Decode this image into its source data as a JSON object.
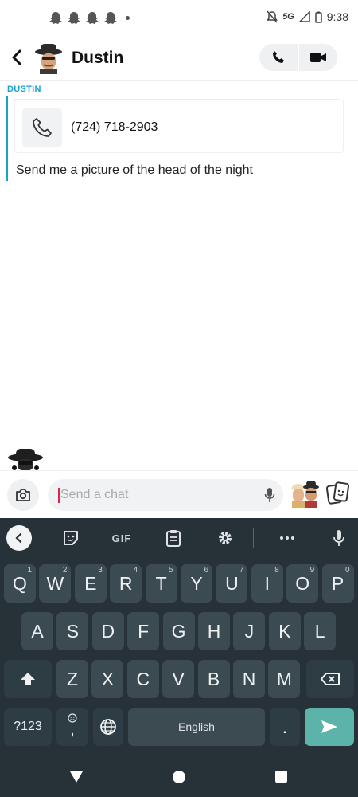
{
  "status_bar": {
    "network": "5G",
    "time": "9:38",
    "icons": [
      "snapchat-ghost-icon",
      "snapchat-ghost-icon",
      "snapchat-ghost-icon",
      "snapchat-ghost-icon",
      "notification-dot",
      "mute-icon",
      "signal-icon",
      "battery-icon"
    ]
  },
  "header": {
    "contact_name": "Dustin",
    "back_icon": "chevron-left-icon",
    "actions": [
      "phone-icon",
      "video-icon"
    ]
  },
  "conversation": {
    "sender_label": "DUSTIN",
    "contact_card": {
      "phone_number": "(724) 718-2903",
      "icon": "phone-icon"
    },
    "message_text": "Send me a picture of the head of the night"
  },
  "chat_input": {
    "placeholder": "Send a chat",
    "icons": [
      "camera-icon",
      "microphone-icon",
      "bitmoji-icon",
      "sticker-icon"
    ]
  },
  "keyboard": {
    "toolbar": {
      "gif_label": "GIF",
      "icons": [
        "back-icon",
        "sticker-icon",
        "clipboard-icon",
        "settings-icon",
        "more-icon",
        "microphone-icon"
      ]
    },
    "row1": [
      {
        "label": "Q",
        "hint": "1"
      },
      {
        "label": "W",
        "hint": "2"
      },
      {
        "label": "E",
        "hint": "3"
      },
      {
        "label": "R",
        "hint": "4"
      },
      {
        "label": "T",
        "hint": "5"
      },
      {
        "label": "Y",
        "hint": "6"
      },
      {
        "label": "U",
        "hint": "7"
      },
      {
        "label": "I",
        "hint": "8"
      },
      {
        "label": "O",
        "hint": "9"
      },
      {
        "label": "P",
        "hint": "0"
      }
    ],
    "row2": [
      "A",
      "S",
      "D",
      "F",
      "G",
      "H",
      "J",
      "K",
      "L"
    ],
    "row3": [
      "Z",
      "X",
      "C",
      "V",
      "B",
      "N",
      "M"
    ],
    "row4": {
      "symbols_label": "?123",
      "emoji_comma": ",",
      "space_label": "English",
      "period": "."
    }
  },
  "colors": {
    "accent": "#1ba2c7",
    "keyboard_bg": "#263238",
    "key_bg": "#3c4a52",
    "enter_key": "#5bb3a9",
    "caret": "#e0244c"
  }
}
